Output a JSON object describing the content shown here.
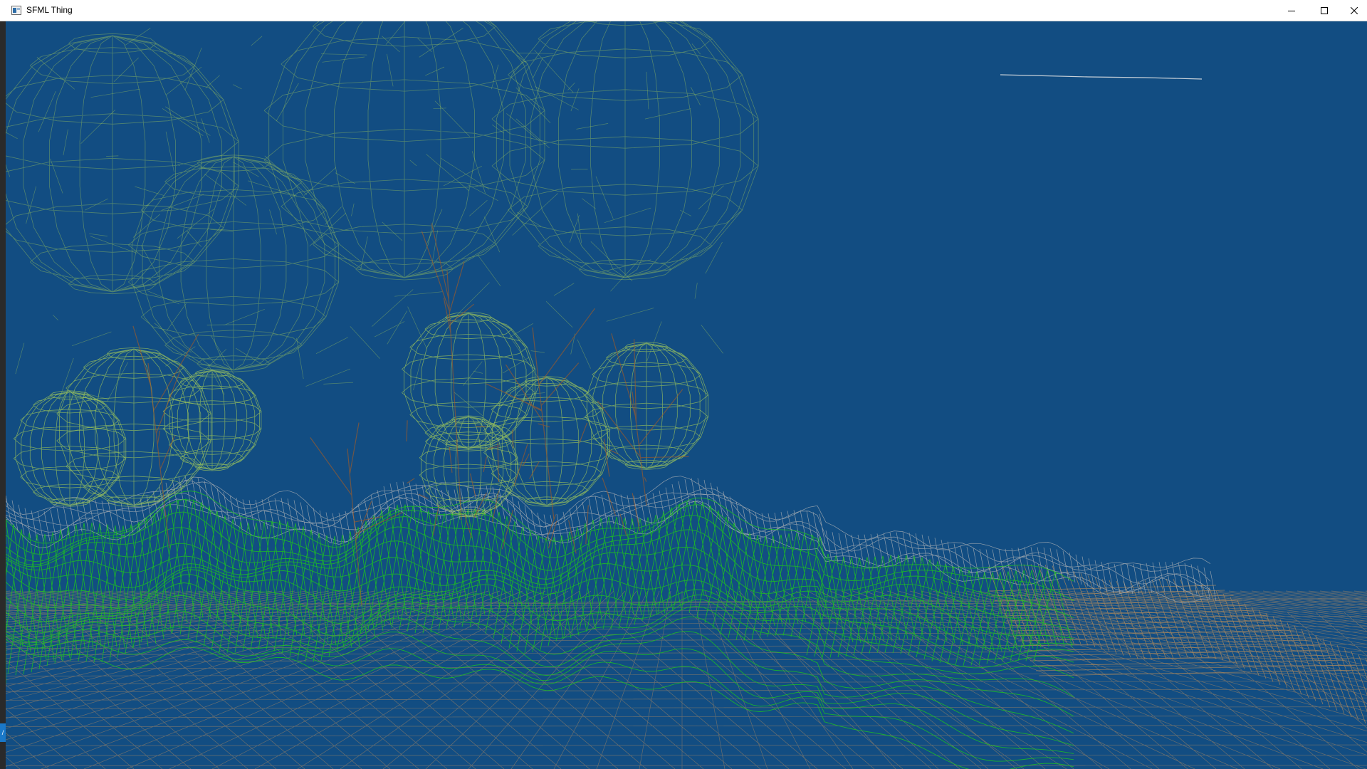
{
  "window": {
    "title": "SFML Thing",
    "background_color": "#124d82",
    "icons": {
      "app": "sfml-window-icon",
      "minimize": "minimize-icon",
      "maximize": "maximize-icon",
      "close": "close-icon"
    }
  },
  "scene": {
    "kind": "3d-wireframe-render",
    "terrain_colors": {
      "grass": "#1ec81a",
      "grass_light": "#7adc4a",
      "rock": "#b8b8b8",
      "sand": "#b08a5a",
      "water_grid": "#b08a60"
    },
    "tree_colors": {
      "foliage": "#9fc85a",
      "trunk": "#a05a28"
    },
    "cloud_color": "#e8e8e8"
  }
}
